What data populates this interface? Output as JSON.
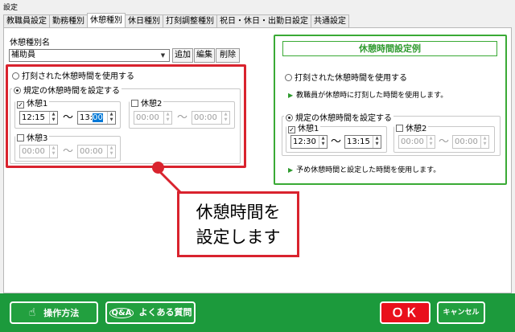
{
  "window": {
    "title": "設定"
  },
  "tabs": [
    "教職員設定",
    "勤務種別",
    "休憩種別",
    "休日種別",
    "打刻調整種別",
    "祝日・休日・出勤日設定",
    "共通設定"
  ],
  "break_type": {
    "name_label": "休憩種別名",
    "name_value": "補助員",
    "add": "追加",
    "edit": "編集",
    "delete": "削除"
  },
  "left": {
    "radio_stamped": "打刻された休憩時間を使用する",
    "radio_rule": "規定の休憩時間を設定する",
    "break1": {
      "label": "休憩1",
      "checked": true,
      "from": "12:15",
      "to_h": "13:",
      "to_m": "00"
    },
    "break2": {
      "label": "休憩2",
      "checked": false,
      "from": "00:00",
      "to": "00:00"
    },
    "break3": {
      "label": "休憩3",
      "checked": false,
      "from": "00:00",
      "to": "00:00"
    },
    "tilde": "〜"
  },
  "example": {
    "title": "休憩時間設定例",
    "radio_stamped": "打刻された休憩時間を使用する",
    "note1": "教職員が休憩時に打刻した時間を使用します。",
    "radio_rule": "規定の休憩時間を設定する",
    "break1": {
      "label": "休憩1",
      "from": "12:30",
      "to": "13:15"
    },
    "break2": {
      "label": "休憩2",
      "from": "00:00",
      "to": "00:00"
    },
    "note2": "予め休憩時間と設定した時間を使用します。",
    "tilde": "〜"
  },
  "callout": {
    "line1": "休憩時間を",
    "line2": "設定します"
  },
  "footer": {
    "howto": "操作方法",
    "faq": "よくある質問",
    "ok": "ＯＫ",
    "cancel": "キャンセル"
  },
  "colors": {
    "accent_green": "#3aaa35",
    "footer_green": "#1c9a3c",
    "highlight_red": "#d9232e",
    "ok_red": "#e9101c"
  }
}
